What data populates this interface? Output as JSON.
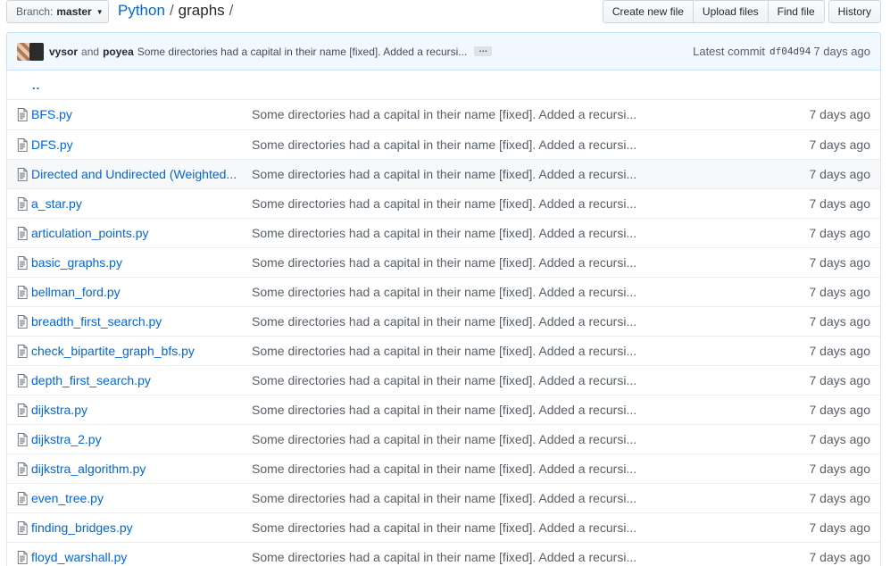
{
  "branch": {
    "prefix": "Branch:",
    "name": "master"
  },
  "breadcrumb": {
    "root": "Python",
    "separator": "/",
    "current": "graphs",
    "trailing": "/"
  },
  "actions": {
    "create_new_file": "Create new file",
    "upload_files": "Upload files",
    "find_file": "Find file",
    "history": "History"
  },
  "commit": {
    "author1": "vysor",
    "and": "and",
    "author2": "poyea",
    "message": "Some directories had a capital in their name [fixed]. Added a recursi...",
    "more": "…",
    "latest_label": "Latest commit",
    "sha": "df04d94",
    "age": "7 days ago"
  },
  "parent_dir": "..",
  "files": [
    {
      "name": "BFS.py",
      "message": "Some directories had a capital in their name [fixed]. Added a recursi...",
      "age": "7 days ago"
    },
    {
      "name": "DFS.py",
      "message": "Some directories had a capital in their name [fixed]. Added a recursi...",
      "age": "7 days ago"
    },
    {
      "name": "Directed and Undirected (Weighted...",
      "message": "Some directories had a capital in their name [fixed]. Added a recursi...",
      "age": "7 days ago"
    },
    {
      "name": "a_star.py",
      "message": "Some directories had a capital in their name [fixed]. Added a recursi...",
      "age": "7 days ago"
    },
    {
      "name": "articulation_points.py",
      "message": "Some directories had a capital in their name [fixed]. Added a recursi...",
      "age": "7 days ago"
    },
    {
      "name": "basic_graphs.py",
      "message": "Some directories had a capital in their name [fixed]. Added a recursi...",
      "age": "7 days ago"
    },
    {
      "name": "bellman_ford.py",
      "message": "Some directories had a capital in their name [fixed]. Added a recursi...",
      "age": "7 days ago"
    },
    {
      "name": "breadth_first_search.py",
      "message": "Some directories had a capital in their name [fixed]. Added a recursi...",
      "age": "7 days ago"
    },
    {
      "name": "check_bipartite_graph_bfs.py",
      "message": "Some directories had a capital in their name [fixed]. Added a recursi...",
      "age": "7 days ago"
    },
    {
      "name": "depth_first_search.py",
      "message": "Some directories had a capital in their name [fixed]. Added a recursi...",
      "age": "7 days ago"
    },
    {
      "name": "dijkstra.py",
      "message": "Some directories had a capital in their name [fixed]. Added a recursi...",
      "age": "7 days ago"
    },
    {
      "name": "dijkstra_2.py",
      "message": "Some directories had a capital in their name [fixed]. Added a recursi...",
      "age": "7 days ago"
    },
    {
      "name": "dijkstra_algorithm.py",
      "message": "Some directories had a capital in their name [fixed]. Added a recursi...",
      "age": "7 days ago"
    },
    {
      "name": "even_tree.py",
      "message": "Some directories had a capital in their name [fixed]. Added a recursi...",
      "age": "7 days ago"
    },
    {
      "name": "finding_bridges.py",
      "message": "Some directories had a capital in their name [fixed]. Added a recursi...",
      "age": "7 days ago"
    },
    {
      "name": "floyd_warshall.py",
      "message": "Some directories had a capital in their name [fixed]. Added a recursi...",
      "age": "7 days ago"
    }
  ],
  "highlighted_row": 2,
  "colors": {
    "link": "#0366d6",
    "muted": "#586069",
    "tease_bg": "#f1f8ff",
    "tease_border": "#c8e1ff"
  },
  "icons": {
    "file": "file-text-icon",
    "caret": "caret-down-icon"
  }
}
